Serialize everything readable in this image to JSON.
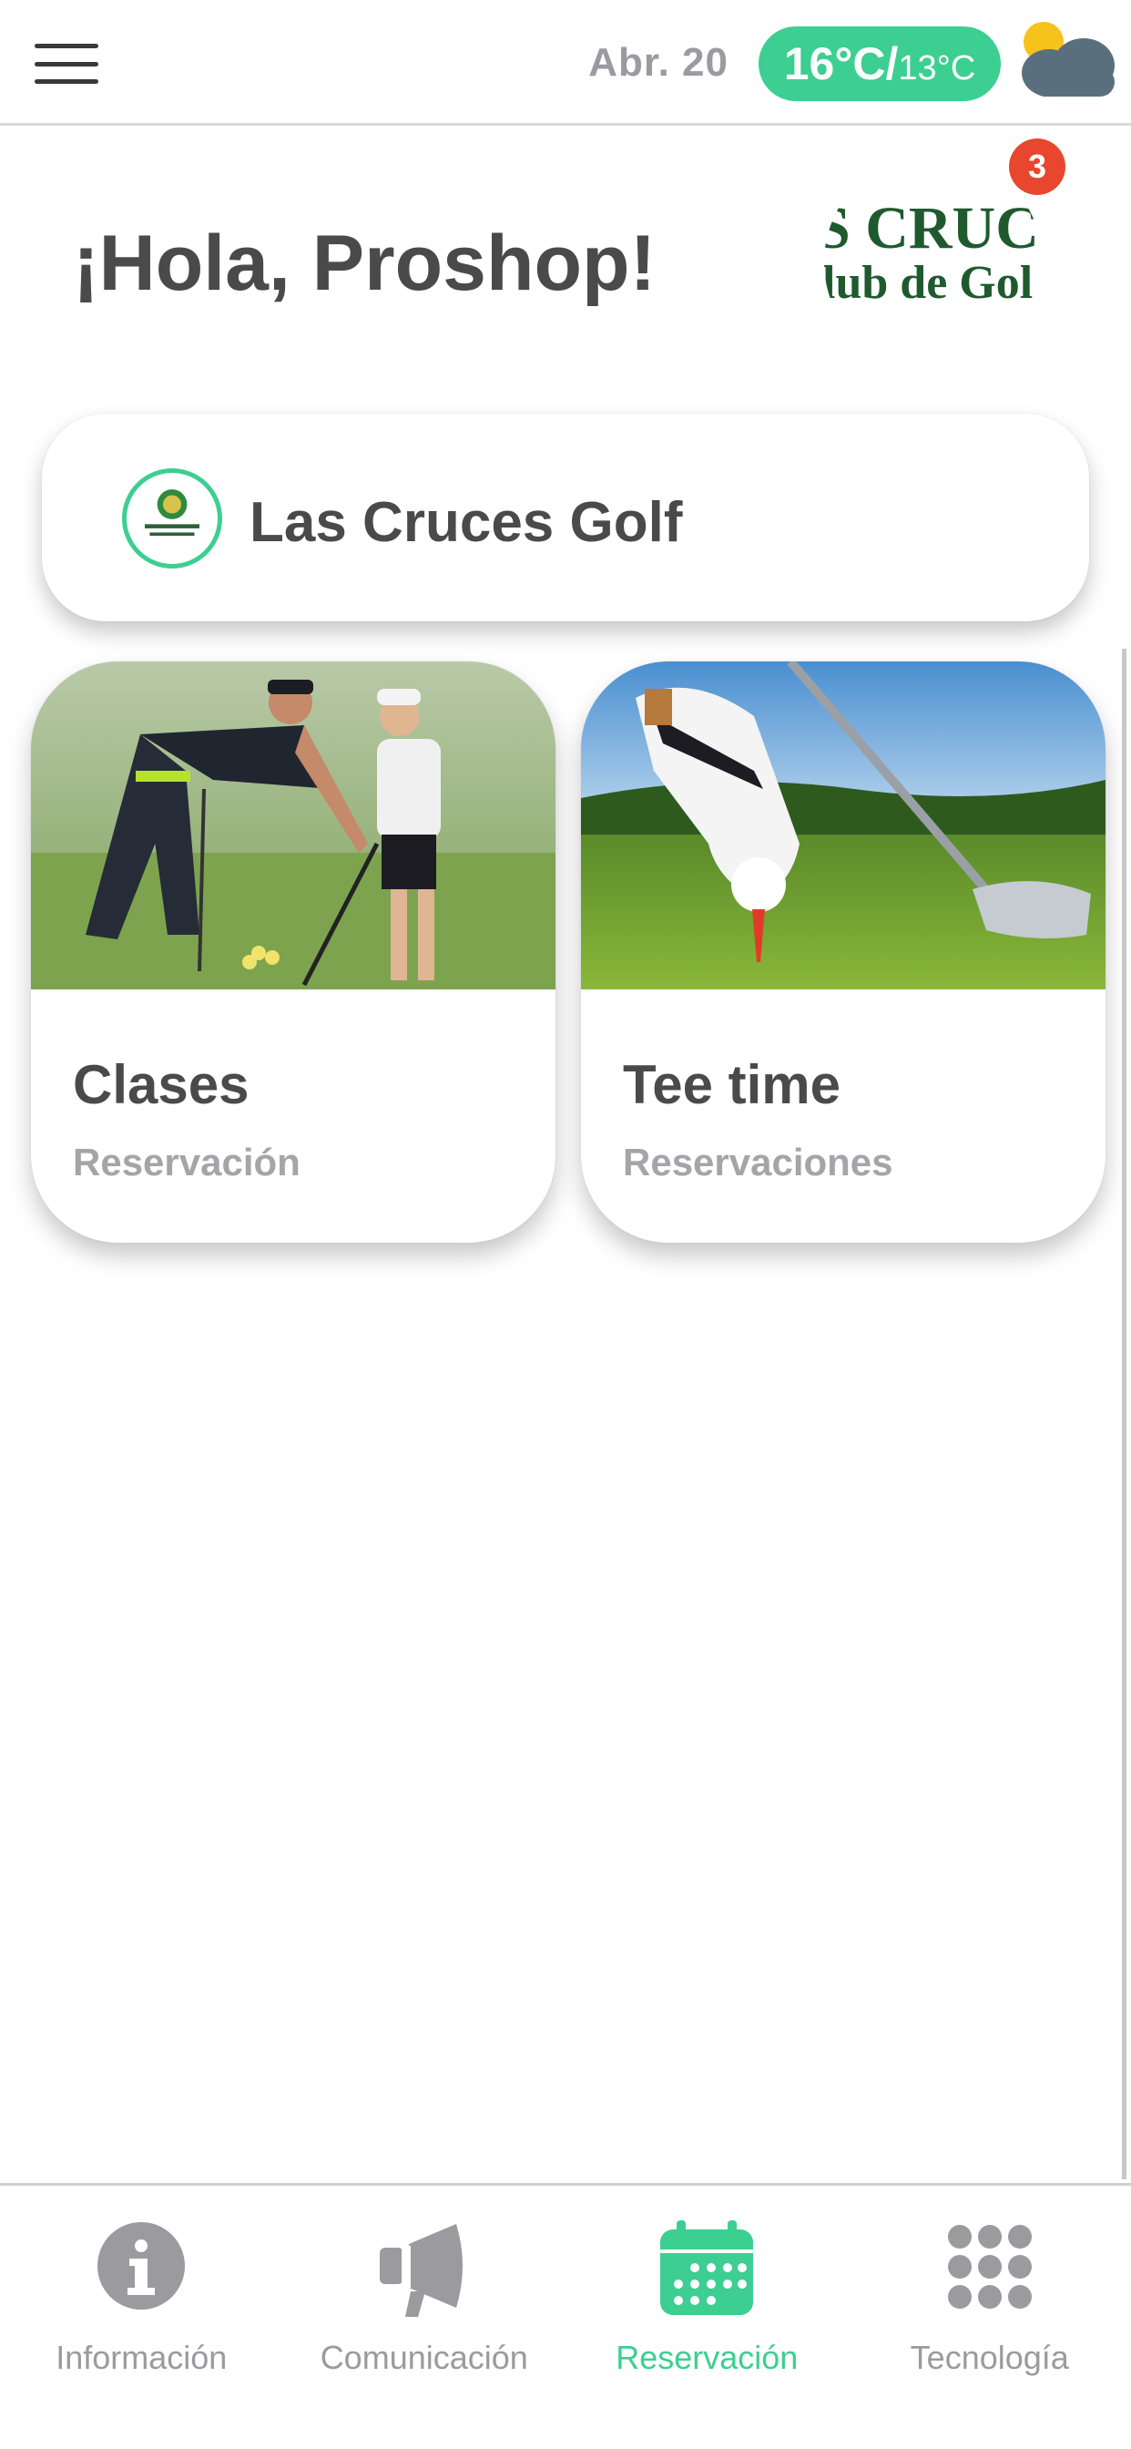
{
  "header": {
    "date": "Abr. 20",
    "temp_high": "16°C/",
    "temp_low": "13°C"
  },
  "greeting": "¡Hola, Proshop!",
  "club_logo": {
    "line1": "S CRUC",
    "line2": "lub de Gol"
  },
  "notifications_count": "3",
  "club_selector": {
    "name": "Las Cruces Golf"
  },
  "services": [
    {
      "title": "Clases",
      "subtitle": "Reservación"
    },
    {
      "title": "Tee time",
      "subtitle": "Reservaciones"
    }
  ],
  "nav": [
    {
      "label": "Información",
      "icon": "info-icon"
    },
    {
      "label": "Comunicación",
      "icon": "megaphone-icon"
    },
    {
      "label": "Reservación",
      "icon": "calendar-icon",
      "active": true
    },
    {
      "label": "Tecnología",
      "icon": "apps-grid-icon"
    }
  ],
  "colors": {
    "accent": "#3ccf91",
    "badge": "#e8462e",
    "text_dark": "#4a4a4a",
    "text_muted": "#a5a5a9",
    "logo_green": "#1f5a2e"
  }
}
